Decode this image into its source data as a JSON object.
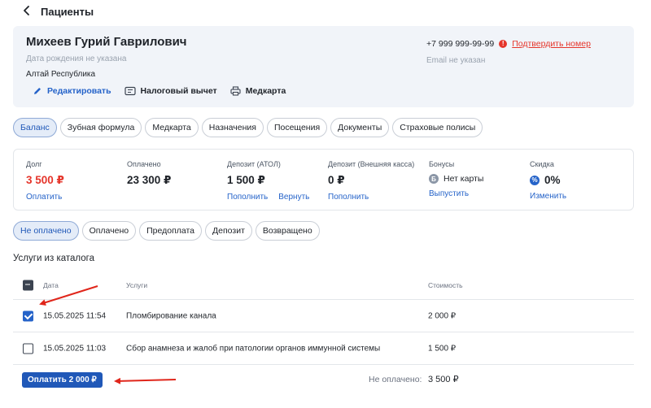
{
  "header": {
    "back_icon": "chevron-left-icon",
    "title": "Пациенты"
  },
  "patient": {
    "name": "Михеев Гурий Гаврилович",
    "dob": "Дата рождения не указана",
    "region": "Алтай Республика",
    "phone": "+7 999 999-99-99",
    "warn_glyph": "!",
    "confirm_label": "Подтвердить номер",
    "email": "Email не указан",
    "actions": {
      "edit": "Редактировать",
      "tax": "Налоговый вычет",
      "medcard": "Медкарта"
    }
  },
  "tabs": [
    {
      "label": "Баланс",
      "active": true
    },
    {
      "label": "Зубная формула"
    },
    {
      "label": "Медкарта"
    },
    {
      "label": "Назначения"
    },
    {
      "label": "Посещения"
    },
    {
      "label": "Документы"
    },
    {
      "label": "Страховые полисы"
    }
  ],
  "balance": {
    "debt": {
      "label": "Долг",
      "value": "3 500 ₽",
      "link": "Оплатить"
    },
    "paid": {
      "label": "Оплачено",
      "value": "23 300 ₽"
    },
    "deposit_atol": {
      "label": "Депозит (АТОЛ)",
      "value": "1 500 ₽",
      "link1": "Пополнить",
      "link2": "Вернуть"
    },
    "deposit_ext": {
      "label": "Депозит (Внешняя касса)",
      "value": "0 ₽",
      "link": "Пополнить"
    },
    "bonus": {
      "label": "Бонусы",
      "icon_glyph": "Б",
      "value": "Нет карты",
      "link": "Выпустить"
    },
    "discount": {
      "label": "Скидка",
      "icon_glyph": "%",
      "value": "0%",
      "link": "Изменить"
    }
  },
  "filters": [
    {
      "label": "Не оплачено",
      "active": true
    },
    {
      "label": "Оплачено"
    },
    {
      "label": "Предоплата"
    },
    {
      "label": "Депозит"
    },
    {
      "label": "Возвращено"
    }
  ],
  "section_title": "Услуги из каталога",
  "table": {
    "headers": {
      "date": "Дата",
      "service": "Услуги",
      "cost": "Стоимость"
    },
    "rows": [
      {
        "checked": true,
        "date": "15.05.2025 11:54",
        "service": "Пломбирование канала",
        "cost": "2 000 ₽"
      },
      {
        "checked": false,
        "date": "15.05.2025 11:03",
        "service": "Сбор анамнеза и жалоб при патологии органов иммунной системы",
        "cost": "1 500 ₽"
      }
    ]
  },
  "footer": {
    "pay_button": "Оплатить 2 000 ₽",
    "unpaid_label": "Не оплачено:",
    "unpaid_value": "3 500 ₽"
  },
  "colors": {
    "accent": "#2563c9",
    "danger": "#e5352b",
    "annotation_arrow": "#e0261b"
  }
}
